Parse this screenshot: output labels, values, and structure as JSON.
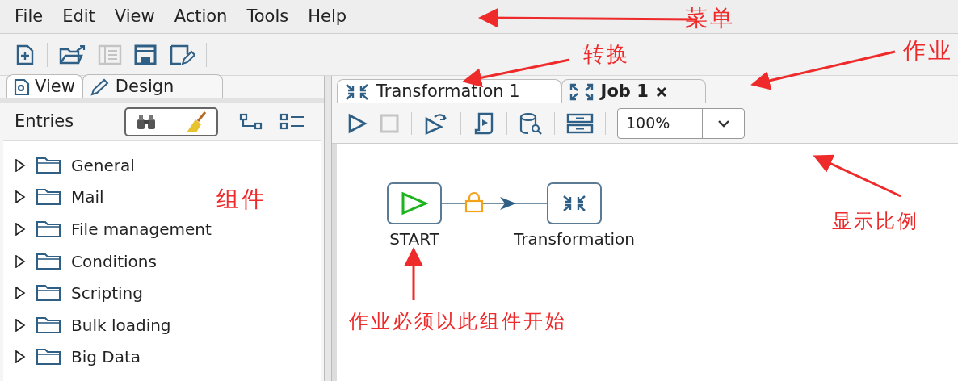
{
  "menu": [
    "File",
    "Edit",
    "View",
    "Action",
    "Tools",
    "Help"
  ],
  "left_tabs": [
    {
      "label": "View",
      "selected": false
    },
    {
      "label": "Design",
      "selected": true
    }
  ],
  "entries_label": "Entries",
  "tree": [
    {
      "label": "General",
      "expanded": false
    },
    {
      "label": "Mail",
      "expanded": false
    },
    {
      "label": "File management",
      "expanded": false
    },
    {
      "label": "Conditions",
      "expanded": false
    },
    {
      "label": "Scripting",
      "expanded": false
    },
    {
      "label": "Bulk loading",
      "expanded": false
    },
    {
      "label": "Big Data",
      "expanded": false
    }
  ],
  "doc_tabs": [
    {
      "label": "Transformation 1",
      "kind": "transformation",
      "selected": false,
      "closable": false
    },
    {
      "label": "Job 1",
      "kind": "job",
      "selected": true,
      "closable": true
    }
  ],
  "zoom": {
    "value": "100%"
  },
  "canvas": {
    "nodes": [
      {
        "label": "START",
        "kind": "start"
      },
      {
        "label": "Transformation",
        "kind": "transformation"
      }
    ]
  },
  "annotations": [
    {
      "text": "菜单",
      "kind": "menu"
    },
    {
      "text": "转换",
      "kind": "transformation-tab"
    },
    {
      "text": "作业",
      "kind": "job-tab"
    },
    {
      "text": "组件",
      "kind": "components"
    },
    {
      "text": "显示比例",
      "kind": "zoom"
    },
    {
      "text": "作业必须以此组件开始",
      "kind": "start"
    }
  ]
}
